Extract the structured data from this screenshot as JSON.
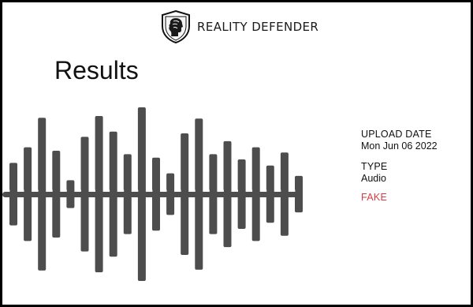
{
  "header": {
    "brand_name": "REALITY DEFENDER",
    "logo_icon": "shield-profile-logo"
  },
  "main": {
    "title": "Results"
  },
  "details": {
    "upload_date_label": "UPLOAD DATE",
    "upload_date_value": "Mon Jun 06 2022",
    "type_label": "TYPE",
    "type_value": "Audio",
    "verdict": "FAKE"
  },
  "waveform": {
    "icon": "audio-waveform-icon",
    "color": "#4d4d4d",
    "levels": [
      0.36,
      0.54,
      0.88,
      0.5,
      0.16,
      0.66,
      0.9,
      0.72,
      0.46,
      1.0,
      0.42,
      0.24,
      0.7,
      0.87,
      0.46,
      0.61,
      0.4,
      0.54,
      0.33,
      0.48,
      0.21
    ]
  },
  "colors": {
    "verdict_fake": "#d63c46",
    "frame": "#000000",
    "background": "#ffffff"
  }
}
